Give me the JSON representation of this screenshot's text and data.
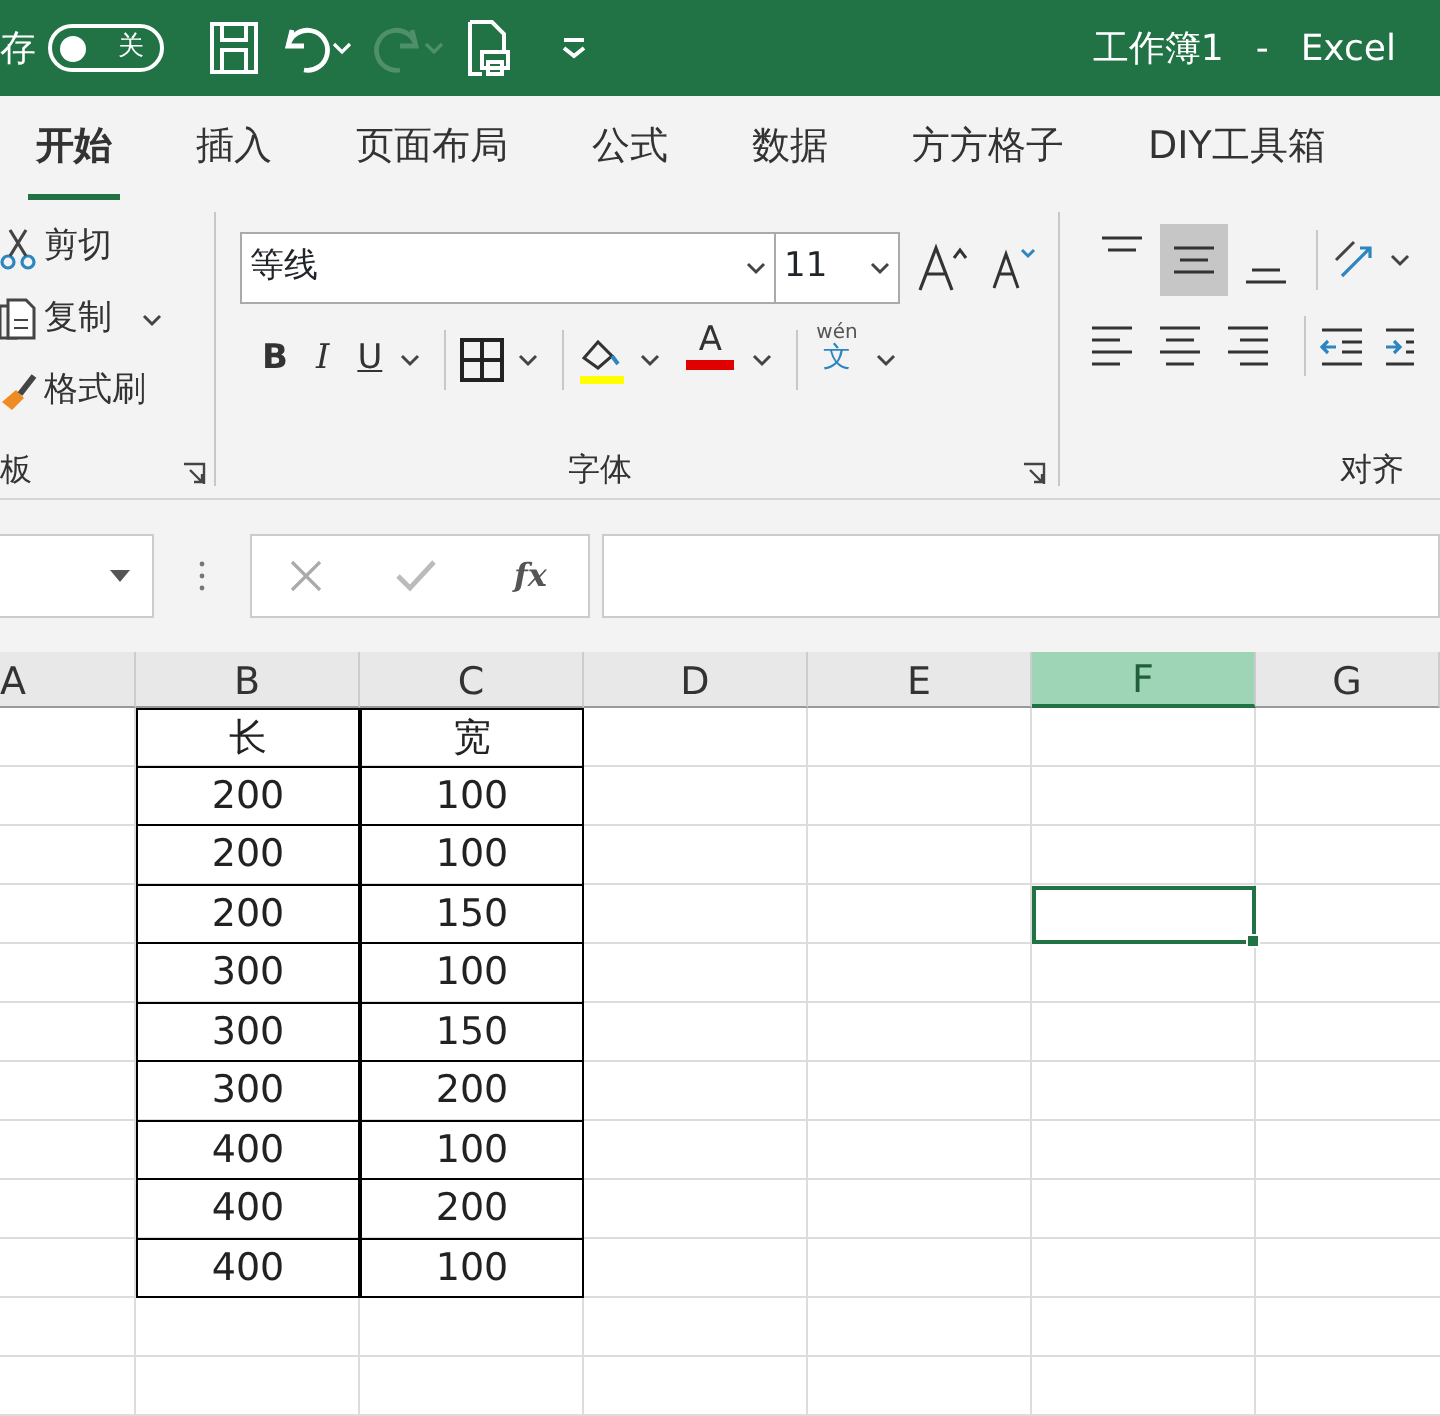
{
  "title_bar": {
    "autosave_label": "存",
    "autosave_toggle": {
      "label": "关",
      "on": false
    },
    "redo_disabled": true,
    "title": "工作簿1",
    "separator": "-",
    "app": "Excel"
  },
  "tabs": [
    {
      "label": "开始",
      "selected": true
    },
    {
      "label": "插入",
      "selected": false
    },
    {
      "label": "页面布局",
      "selected": false
    },
    {
      "label": "公式",
      "selected": false
    },
    {
      "label": "数据",
      "selected": false
    },
    {
      "label": "方方格子",
      "selected": false
    },
    {
      "label": "DIY工具箱",
      "selected": false
    }
  ],
  "clipboard": {
    "items": [
      {
        "label": "剪切",
        "kind": "cut"
      },
      {
        "label": "复制",
        "kind": "copy"
      },
      {
        "label": "格式刷",
        "kind": "painter"
      }
    ],
    "group_label": "板"
  },
  "font": {
    "font_name": "等线",
    "font_size": "11",
    "bold_label": "B",
    "italic_label": "I",
    "underline_label": "U",
    "font_color_label": "A",
    "phonetic_label": "wén",
    "phonetic_char": "文",
    "group_label": "字体"
  },
  "alignment": {
    "vertical": [
      {
        "kind": "top",
        "selected": false
      },
      {
        "kind": "middle",
        "selected": true
      },
      {
        "kind": "bottom",
        "selected": false
      }
    ],
    "group_label": "对齐"
  },
  "formula_bar": {
    "function_label": "fx"
  },
  "sheet": {
    "columns": [
      {
        "label": "A",
        "selected": false
      },
      {
        "label": "B",
        "selected": false
      },
      {
        "label": "C",
        "selected": false
      },
      {
        "label": "D",
        "selected": false
      },
      {
        "label": "E",
        "selected": false
      },
      {
        "label": "F",
        "selected": true
      },
      {
        "label": "G",
        "selected": false
      }
    ],
    "rows": [
      {
        "B": "长",
        "C": "宽",
        "selected": false
      },
      {
        "B": "200",
        "C": "100",
        "selected": false
      },
      {
        "B": "200",
        "C": "100",
        "selected": false
      },
      {
        "B": "200",
        "C": "150",
        "selected": true
      },
      {
        "B": "300",
        "C": "100",
        "selected": false
      },
      {
        "B": "300",
        "C": "150",
        "selected": false
      },
      {
        "B": "300",
        "C": "200",
        "selected": false
      },
      {
        "B": "400",
        "C": "100",
        "selected": false
      },
      {
        "B": "400",
        "C": "200",
        "selected": false
      },
      {
        "B": "400",
        "C": "100",
        "selected": false
      },
      {
        "selected": false
      },
      {
        "selected": false
      }
    ]
  }
}
